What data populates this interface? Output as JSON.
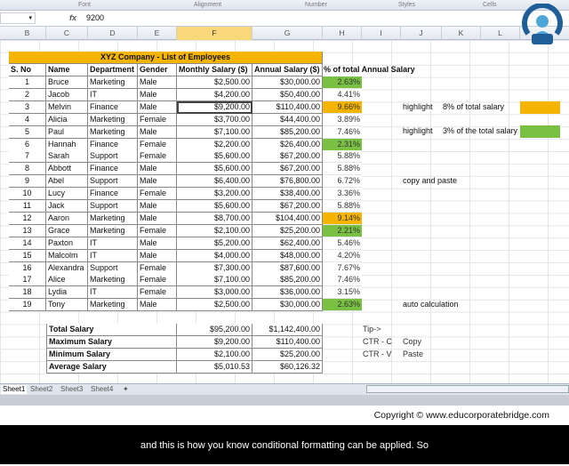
{
  "ribbon": {
    "groups": [
      "Font",
      "Alignment",
      "Number",
      "Styles",
      "Cells"
    ]
  },
  "formula_bar": {
    "fx": "fx",
    "value": "9200"
  },
  "columns": [
    "B",
    "C",
    "D",
    "E",
    "F",
    "G",
    "H",
    "I",
    "J",
    "K",
    "L"
  ],
  "table": {
    "title": "XYZ Company - List of Employees",
    "headers": [
      "S. No",
      "Name",
      "Department",
      "Gender",
      "Monthly Salary ($)",
      "Annual Salary ($)",
      "% of total Annual Salary"
    ],
    "rows": [
      [
        "1",
        "Bruce",
        "Marketing",
        "Male",
        "$2,500.00",
        "$30,000.00",
        "2.63%"
      ],
      [
        "2",
        "Jacob",
        "IT",
        "Male",
        "$4,200.00",
        "$50,400.00",
        "4.41%"
      ],
      [
        "3",
        "Melvin",
        "Finance",
        "Male",
        "$9,200.00",
        "$110,400.00",
        "9.66%"
      ],
      [
        "4",
        "Alicia",
        "Marketing",
        "Female",
        "$3,700.00",
        "$44,400.00",
        "3.89%"
      ],
      [
        "5",
        "Paul",
        "Marketing",
        "Male",
        "$7,100.00",
        "$85,200.00",
        "7.46%"
      ],
      [
        "6",
        "Hannah",
        "Finance",
        "Female",
        "$2,200.00",
        "$26,400.00",
        "2.31%"
      ],
      [
        "7",
        "Sarah",
        "Support",
        "Female",
        "$5,600.00",
        "$67,200.00",
        "5.88%"
      ],
      [
        "8",
        "Abbott",
        "Finance",
        "Male",
        "$5,600.00",
        "$67,200.00",
        "5.88%"
      ],
      [
        "9",
        "Abel",
        "Support",
        "Male",
        "$6,400.00",
        "$76,800.00",
        "6.72%"
      ],
      [
        "10",
        "Lucy",
        "Finance",
        "Female",
        "$3,200.00",
        "$38,400.00",
        "3.36%"
      ],
      [
        "11",
        "Jack",
        "Support",
        "Male",
        "$5,600.00",
        "$67,200.00",
        "5.88%"
      ],
      [
        "12",
        "Aaron",
        "Marketing",
        "Male",
        "$8,700.00",
        "$104,400.00",
        "9.14%"
      ],
      [
        "13",
        "Grace",
        "Marketing",
        "Female",
        "$2,100.00",
        "$25,200.00",
        "2.21%"
      ],
      [
        "14",
        "Paxton",
        "IT",
        "Male",
        "$5,200.00",
        "$62,400.00",
        "5.46%"
      ],
      [
        "15",
        "Malcolm",
        "IT",
        "Male",
        "$4,000.00",
        "$48,000.00",
        "4.20%"
      ],
      [
        "16",
        "Alexandra",
        "Support",
        "Female",
        "$7,300.00",
        "$87,600.00",
        "7.67%"
      ],
      [
        "17",
        "Alice",
        "Marketing",
        "Female",
        "$7,100.00",
        "$85,200.00",
        "7.46%"
      ],
      [
        "18",
        "Lydia",
        "IT",
        "Female",
        "$3,000.00",
        "$36,000.00",
        "3.15%"
      ],
      [
        "19",
        "Tony",
        "Marketing",
        "Male",
        "$2,500.00",
        "$30,000.00",
        "2.63%"
      ]
    ],
    "highlights": {
      "orange": [
        2,
        11
      ],
      "green": [
        0,
        5,
        12,
        18
      ]
    }
  },
  "summary": [
    [
      "Total Salary",
      "$95,200.00",
      "$1,142,400.00"
    ],
    [
      "Maximum Salary",
      "$9,200.00",
      "$110,400.00"
    ],
    [
      "Minimum Salary",
      "$2,100.00",
      "$25,200.00"
    ],
    [
      "Average Salary",
      "$5,010.53",
      "$60,126.32"
    ]
  ],
  "notes": {
    "h1_a": "highlight",
    "h1_b": "8% of total salary",
    "h2_a": "highlight",
    "h2_b": "3% of the total salary",
    "copy_paste": "copy and paste",
    "auto": "auto calculation",
    "tip": "Tip->",
    "ctrc": "CTR - C",
    "copy": "Copy",
    "ctrv": "CTR - V",
    "paste": "Paste"
  },
  "colors": {
    "orange": "#f5b400",
    "green": "#7ac143",
    "title_bg": "#f5b400"
  },
  "sheets": [
    "Sheet1",
    "Sheet2",
    "Sheet3",
    "Sheet4"
  ],
  "copyright": "Copyright © www.educorporatebridge.com",
  "caption": "and this is how you know conditional formatting can be applied. So"
}
